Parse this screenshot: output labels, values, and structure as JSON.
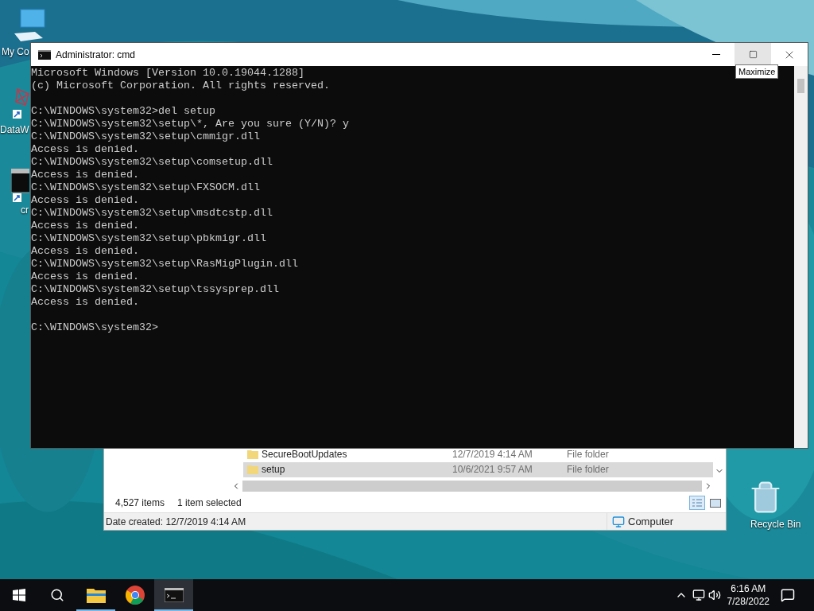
{
  "desktop_icons": [
    {
      "kind": "computer",
      "label": "My Co"
    },
    {
      "kind": "molecule-shortcut",
      "label": "DataW"
    },
    {
      "kind": "console-shortcut",
      "label": "cr"
    },
    {
      "kind": "recycle",
      "label": "Recycle Bin"
    }
  ],
  "explorer": {
    "rows": [
      {
        "name": "SecureBootUpdates",
        "date": "12/7/2019 4:14 AM",
        "type": "File folder",
        "selected": false
      },
      {
        "name": "setup",
        "date": "10/6/2021 9:57 AM",
        "type": "File folder",
        "selected": true
      }
    ],
    "item_count": "4,527 items",
    "selection": "1 item selected",
    "date_created": "Date created: 12/7/2019 4:14 AM",
    "zone": "Computer"
  },
  "cmd_window": {
    "title": "Administrator: cmd",
    "tooltip": "Maximize",
    "lines": [
      {
        "kind": "text",
        "text": "Microsoft Windows [Version 10.0.19044.1288]"
      },
      {
        "kind": "text",
        "text": "(c) Microsoft Corporation. All rights reserved."
      },
      {
        "kind": "blank"
      },
      {
        "kind": "text",
        "text": "C:\\WINDOWS\\system32>del setup"
      },
      {
        "kind": "text",
        "text": "C:\\WINDOWS\\system32\\setup\\*, Are you sure (Y/N)? y"
      },
      {
        "kind": "text",
        "text": "C:\\WINDOWS\\system32\\setup\\cmmigr.dll"
      },
      {
        "kind": "text",
        "text": "Access is denied."
      },
      {
        "kind": "text",
        "text": "C:\\WINDOWS\\system32\\setup\\comsetup.dll"
      },
      {
        "kind": "text",
        "text": "Access is denied."
      },
      {
        "kind": "text",
        "text": "C:\\WINDOWS\\system32\\setup\\FXSOCM.dll"
      },
      {
        "kind": "text",
        "text": "Access is denied."
      },
      {
        "kind": "text",
        "text": "C:\\WINDOWS\\system32\\setup\\msdtcstp.dll"
      },
      {
        "kind": "text",
        "text": "Access is denied."
      },
      {
        "kind": "text",
        "text": "C:\\WINDOWS\\system32\\setup\\pbkmigr.dll"
      },
      {
        "kind": "text",
        "text": "Access is denied."
      },
      {
        "kind": "text",
        "text": "C:\\WINDOWS\\system32\\setup\\RasMigPlugin.dll"
      },
      {
        "kind": "text",
        "text": "Access is denied."
      },
      {
        "kind": "text",
        "text": "C:\\WINDOWS\\system32\\setup\\tssysprep.dll"
      },
      {
        "kind": "text",
        "text": "Access is denied."
      },
      {
        "kind": "blank"
      },
      {
        "kind": "text",
        "text": "C:\\WINDOWS\\system32>"
      }
    ]
  },
  "taskbar": {
    "apps": [
      {
        "kind": "folder",
        "running": true,
        "selected": false
      },
      {
        "kind": "browser",
        "running": false,
        "selected": false
      },
      {
        "kind": "console",
        "running": true,
        "selected": true
      }
    ],
    "time": "6:16 AM",
    "date": "7/28/2022"
  }
}
